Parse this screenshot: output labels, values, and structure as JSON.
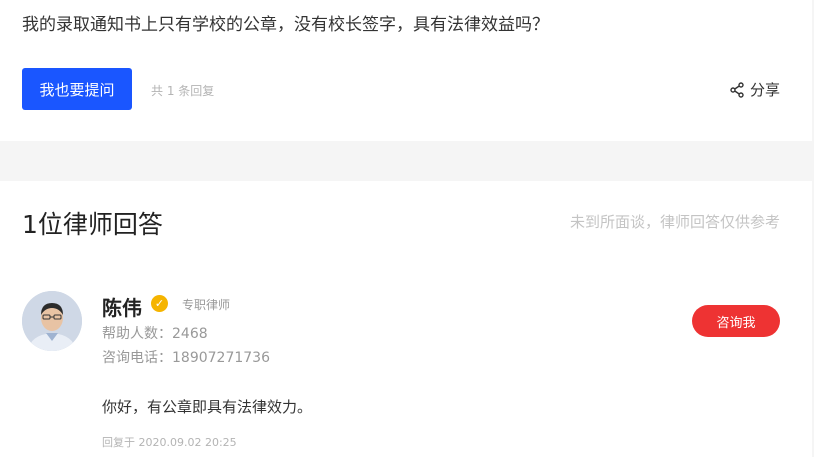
{
  "question": {
    "text": "我的录取通知书上只有学校的公章，没有校长签字，具有法律效益吗？",
    "ask_button_label": "我也要提问",
    "reply_count": "共 1 条回复",
    "share_label": "分享"
  },
  "answers_section": {
    "title": "1位律师回答",
    "note": "未到所面谈，律师回答仅供参考"
  },
  "lawyer": {
    "name": "陈伟",
    "verified_mark": "✓",
    "role": "专职律师",
    "help_count": "帮助人数：2468",
    "phone": "咨询电话：18907271736",
    "consult_button_label": "咨询我"
  },
  "answer": {
    "text": "你好，有公章即具有法律效力。",
    "reply_time": "回复于 2020.09.02 20:25"
  },
  "colors": {
    "primary_blue": "#1a56ff",
    "consult_red": "#ee3333",
    "verified_gold": "#f5b400"
  },
  "icons": {
    "share": "share-icon",
    "verified": "verified-badge-icon"
  }
}
